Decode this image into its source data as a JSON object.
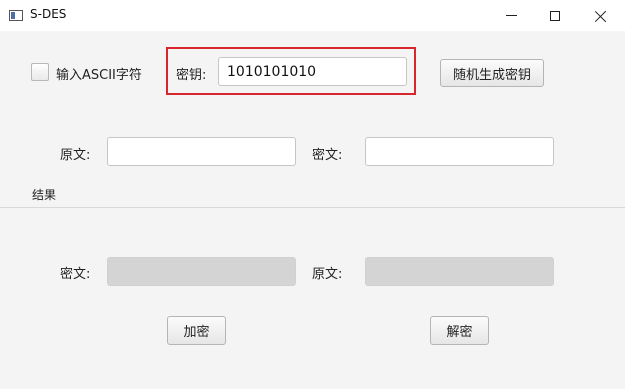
{
  "window": {
    "title": "S-DES",
    "controls": {
      "minimize": "minimize",
      "maximize": "maximize",
      "close": "close"
    }
  },
  "options": {
    "ascii_checkbox_label": "输入ASCII字符",
    "ascii_checked": false
  },
  "key": {
    "label": "密钥:",
    "value": "1010101010",
    "random_button": "随机生成密钥"
  },
  "input": {
    "plaintext_label": "原文:",
    "plaintext_value": "",
    "ciphertext_label": "密文:",
    "ciphertext_value": ""
  },
  "result": {
    "section_label": "结果",
    "ciphertext_label": "密文:",
    "ciphertext_value": "",
    "plaintext_label": "原文:",
    "plaintext_value": ""
  },
  "actions": {
    "encrypt": "加密",
    "decrypt": "解密"
  },
  "colors": {
    "highlight": "#d7262d",
    "background": "#f4f4f4",
    "readonly_field": "#d4d4d4"
  }
}
